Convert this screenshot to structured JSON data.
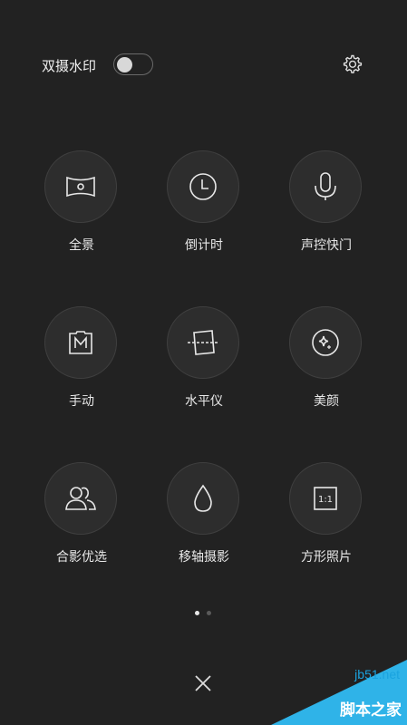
{
  "header": {
    "dual_watermark_label": "双摄水印",
    "dual_watermark_enabled": false
  },
  "modes": [
    {
      "label": "全景"
    },
    {
      "label": "倒计时"
    },
    {
      "label": "声控快门"
    },
    {
      "label": "手动"
    },
    {
      "label": "水平仪"
    },
    {
      "label": "美颜"
    },
    {
      "label": "合影优选"
    },
    {
      "label": "移轴摄影"
    },
    {
      "label": "方形照片"
    }
  ],
  "pagination": {
    "current": 1,
    "total": 2
  },
  "watermark": {
    "site": "jb51.net",
    "name": "脚本之家"
  },
  "icons": {
    "settings": "gear-icon",
    "close": "close-icon",
    "panorama": "panorama-icon",
    "timer": "clock-icon",
    "voice": "microphone-icon",
    "manual": "manual-m-icon",
    "level": "level-icon",
    "beauty": "sparkle-icon",
    "group": "group-people-icon",
    "tiltshift": "droplet-icon",
    "square": "square-1-1-icon"
  },
  "colors": {
    "background": "#222222",
    "accent": "#2fb3e8"
  }
}
